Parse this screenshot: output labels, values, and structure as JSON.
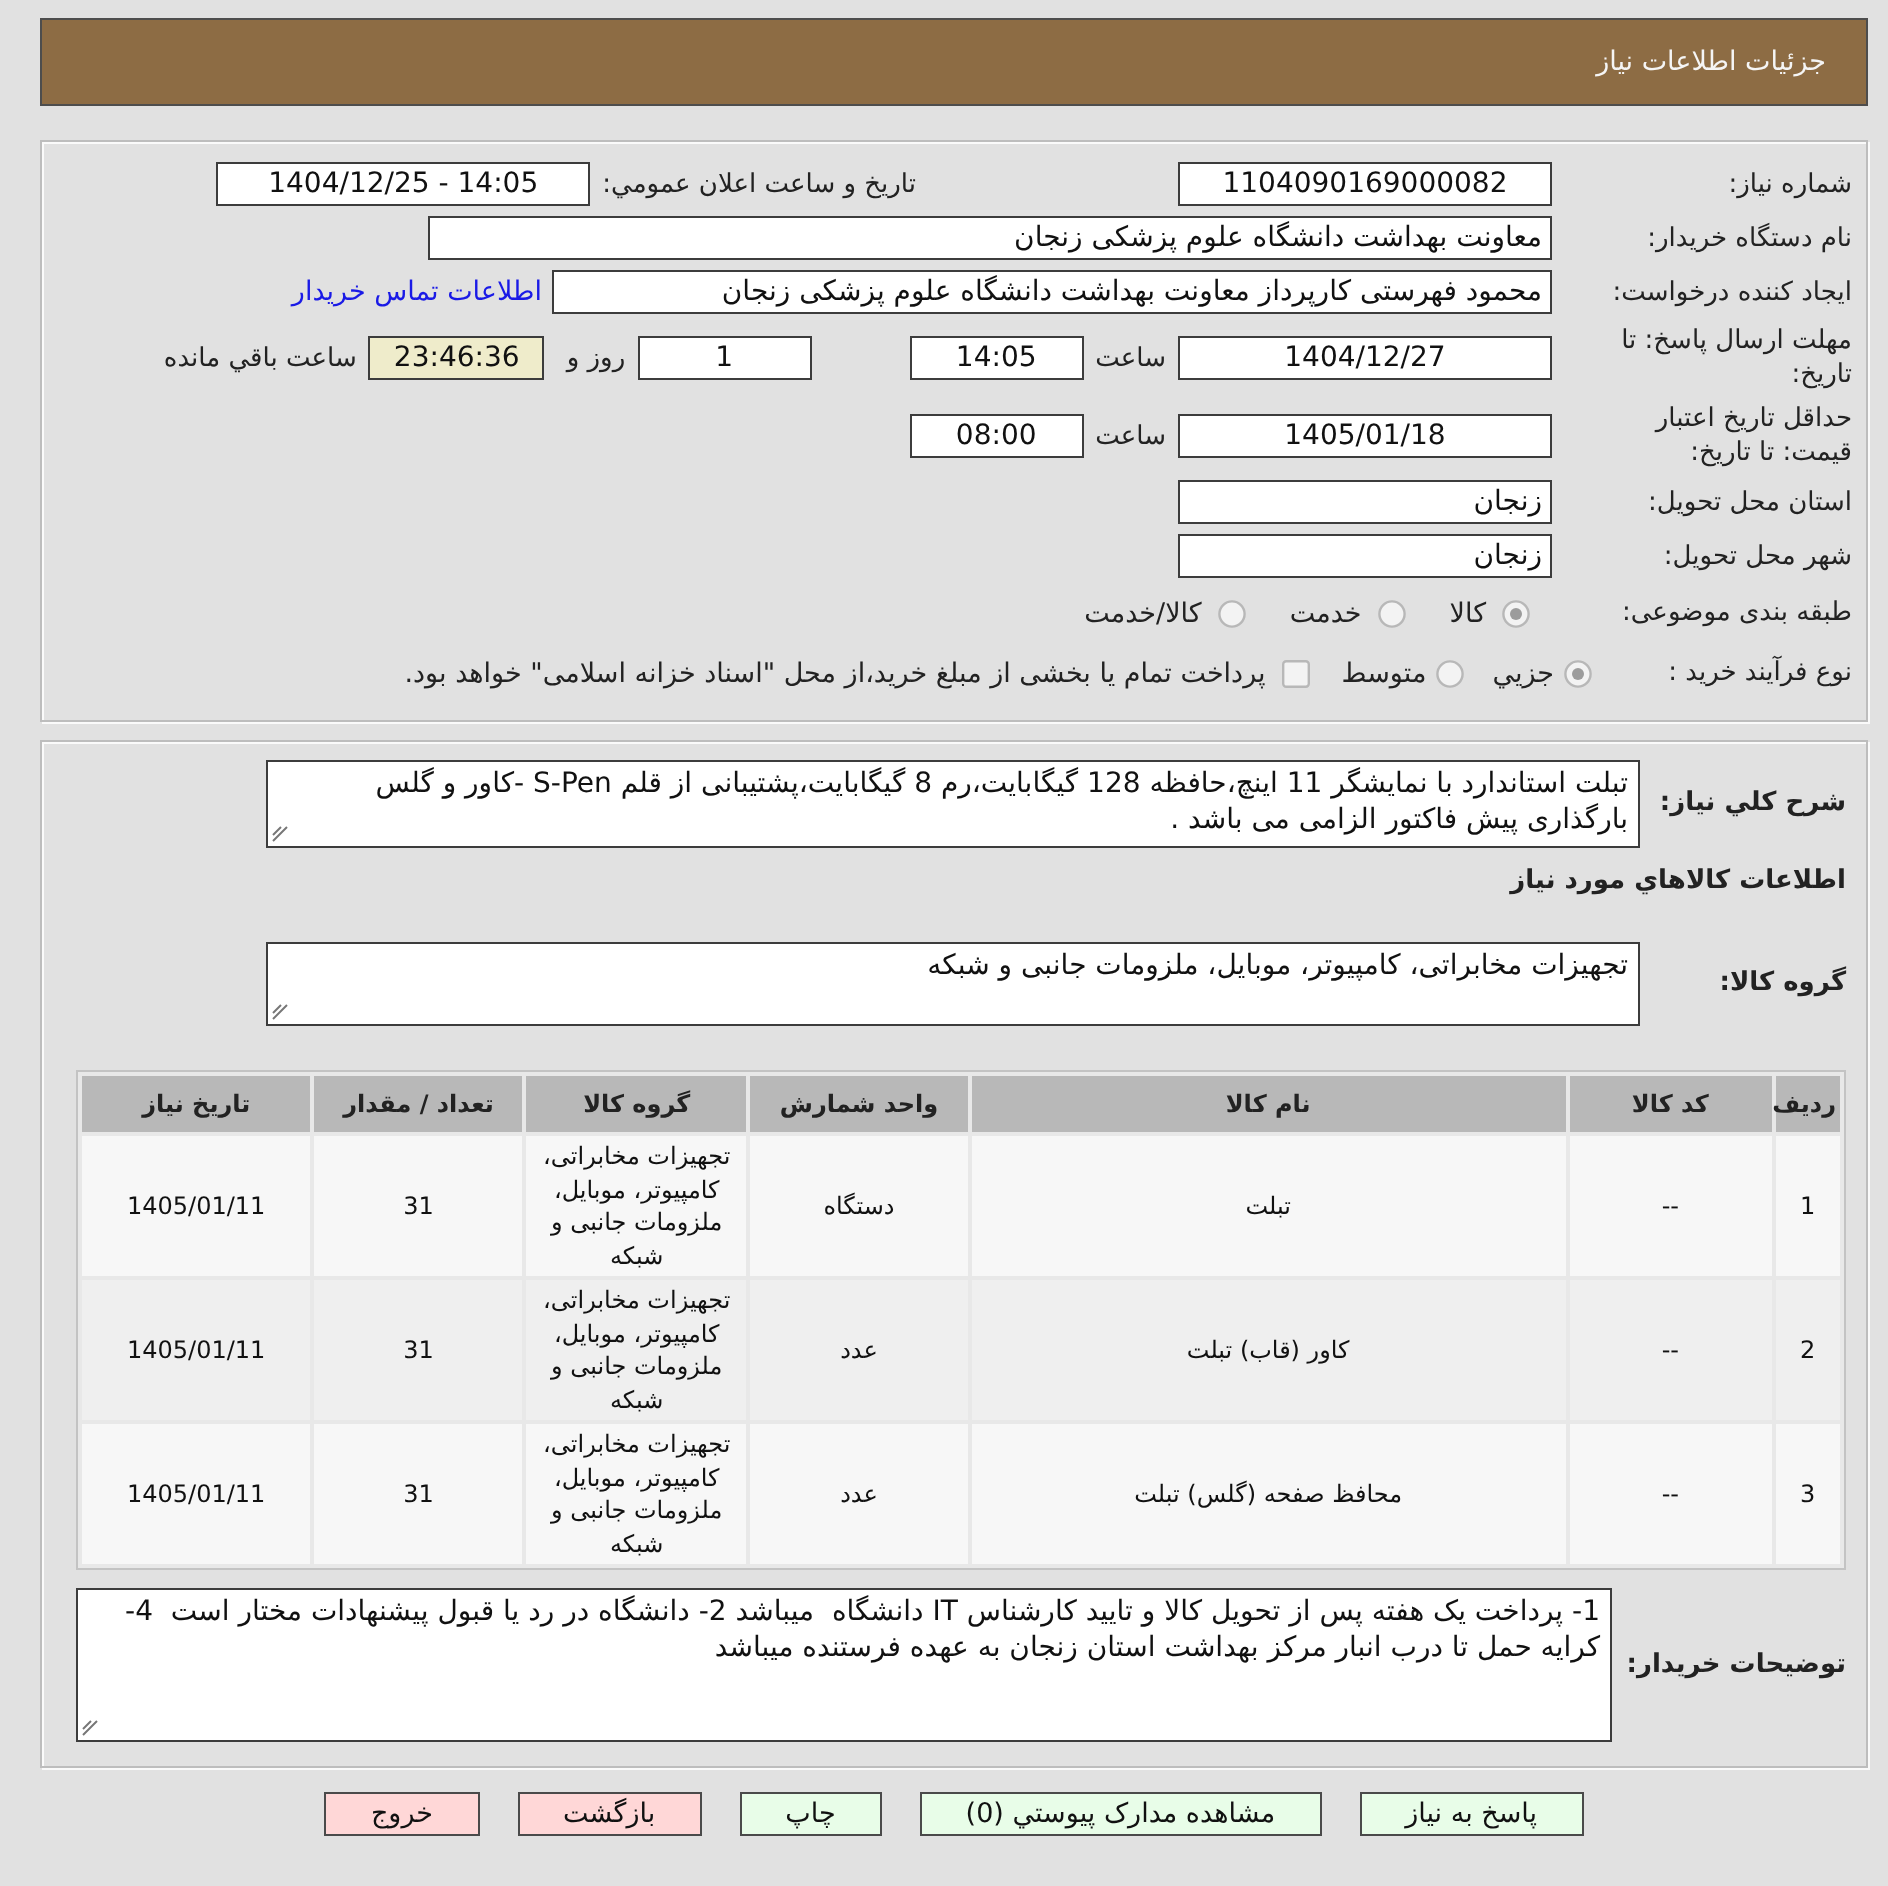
{
  "header": {
    "title": "جزئیات اطلاعات نیاز"
  },
  "need_details": {
    "need_number": {
      "label": "شماره نیاز:",
      "value": "1104090169000082"
    },
    "announcement": {
      "label": "تاریخ و ساعت اعلان عمومي:",
      "value": "1404/12/25 - 14:05"
    },
    "buyer_organization": {
      "label": "نام دستگاه خریدار:",
      "value": "معاونت بهداشت دانشگاه علوم پزشکی زنجان"
    },
    "requester": {
      "label": "ایجاد کننده درخواست:",
      "value": "محمود فهرستی کارپرداز معاونت بهداشت دانشگاه علوم پزشکی زنجان",
      "contact_link": "اطلاعات تماس خریدار"
    },
    "response_deadline": {
      "label": "مهلت ارسال پاسخ: تا تاریخ:",
      "date": "1404/12/27",
      "time_label": "ساعت",
      "time": "14:05",
      "days": "1",
      "days_label": "روز و",
      "remaining_time": "23:46:36",
      "remaining_label": "ساعت باقي مانده"
    },
    "price_validity": {
      "label": "حداقل تاریخ اعتبار قیمت: تا تاریخ:",
      "date": "1405/01/18",
      "time_label": "ساعت",
      "time": "08:00"
    },
    "delivery_province": {
      "label": "استان محل تحویل:",
      "value": "زنجان"
    },
    "delivery_city": {
      "label": "شهر محل تحویل:",
      "value": "زنجان"
    },
    "subject_category": {
      "label": "طبقه بندی موضوعی:",
      "options": [
        {
          "label": "کالا",
          "selected": true
        },
        {
          "label": "خدمت",
          "selected": false
        },
        {
          "label": "کالا/خدمت",
          "selected": false
        }
      ]
    },
    "purchase_process": {
      "label": "نوع فرآیند خرید :",
      "options": [
        {
          "label": "جزيي",
          "selected": true
        },
        {
          "label": "متوسط",
          "selected": false
        }
      ],
      "treasury_payment": {
        "label": "پرداخت تمام یا بخشی از مبلغ خرید،از محل \"اسناد خزانه اسلامی\" خواهد بود.",
        "checked": false
      }
    }
  },
  "need_description": {
    "label": "شرح كلي نیاز:",
    "text": "تبلت استاندارد با نمایشگر 11 اینچ،حافظه 128 گیگابایت،رم 8 گیگابایت،پشتیبانی از قلم S-Pen -کاور و گلس بارگذاری پیش فاکتور الزامی می باشد ."
  },
  "goods_info": {
    "title": "اطلاعات كالاهاي مورد نیاز",
    "group_label": "گروه کالا:",
    "group_value": "تجهیزات مخابراتی، کامپیوتر، موبایل، ملزومات جانبی و شبکه"
  },
  "table": {
    "columns": [
      "ردیف",
      "کد کالا",
      "نام کالا",
      "واحد شمارش",
      "گروه کالا",
      "تعداد / مقدار",
      "تاریخ نیاز"
    ],
    "rows": [
      [
        "1",
        "--",
        "تبلت",
        "دستگاه",
        "تجهیزات مخابراتی، کامپیوتر، موبایل، ملزومات جانبی و شبکه",
        "31",
        "1405/01/11"
      ],
      [
        "2",
        "--",
        "کاور (قاب) تبلت",
        "عدد",
        "تجهیزات مخابراتی، کامپیوتر، موبایل، ملزومات جانبی و شبکه",
        "31",
        "1405/01/11"
      ],
      [
        "3",
        "--",
        "محافظ صفحه (گلس) تبلت",
        "عدد",
        "تجهیزات مخابراتی، کامپیوتر، موبایل، ملزومات جانبی و شبکه",
        "31",
        "1405/01/11"
      ]
    ]
  },
  "buyer_notes": {
    "label": "توضیحات خریدار:",
    "text": "1- پرداخت یک هفته پس از تحویل کالا و تایید کارشناس IT دانشگاه  میباشد 2- دانشگاه در رد یا قبول پیشنهادات مختار است  4- کرایه حمل تا درب انبار مرکز بهداشت استان زنجان به عهده فرستنده میباشد"
  },
  "buttons": [
    {
      "label": "پاسخ به نیاز",
      "kind": "action"
    },
    {
      "label": "مشاهده مدارک پیوستي (0)",
      "kind": "action"
    },
    {
      "label": "چاپ",
      "kind": "action"
    },
    {
      "label": "بازگشت",
      "kind": "exit"
    },
    {
      "label": "خروج",
      "kind": "exit"
    }
  ]
}
